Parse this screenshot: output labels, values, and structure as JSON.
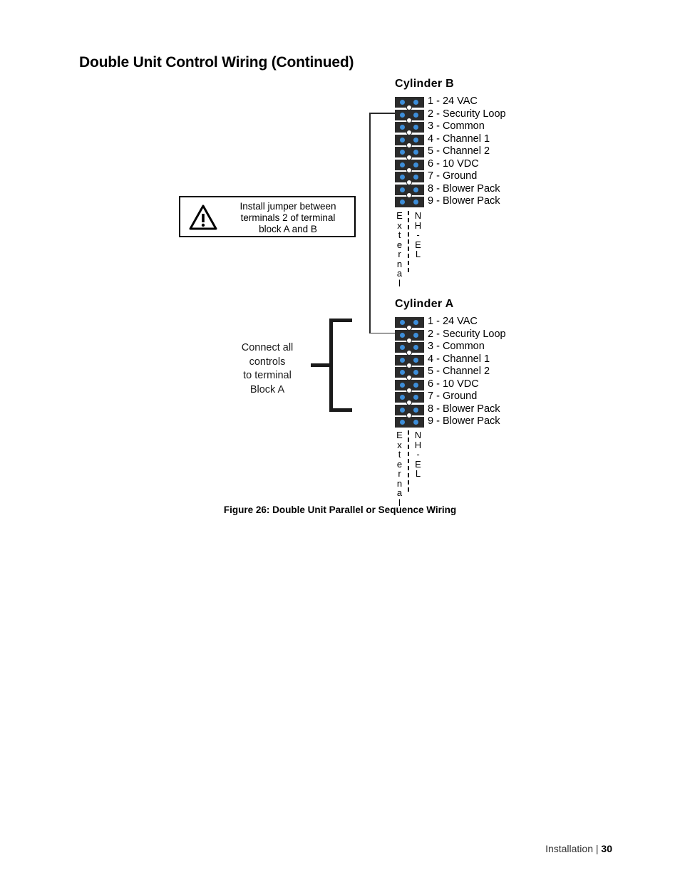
{
  "page": {
    "title": "Double Unit Control Wiring (Continued)",
    "figure_caption": "Figure 26: Double Unit Parallel or Sequence Wiring",
    "footer": {
      "section": "Installation",
      "separator": "|",
      "page_number": "30"
    }
  },
  "colors": {
    "terminal_block": "#2b2b2b",
    "terminal_dot": "#3d8ed9",
    "screw": "#ffffff",
    "wire": "#1a1a1a",
    "text": "#000000"
  },
  "warning": {
    "icon": "warning-triangle-icon",
    "line1": "Install jumper between",
    "line2": "terminals 2 of terminal",
    "line3": "block A and B"
  },
  "connect_note": {
    "line1": "Connect all",
    "line2": "controls",
    "line3": "to terminal",
    "line4": "Block A"
  },
  "terminal_labels": {
    "left_header": "External",
    "right_header": "NH-EL",
    "left_chars": [
      "E",
      "x",
      "t",
      "e",
      "r",
      "n",
      "a",
      "l"
    ],
    "right_chars": [
      "N",
      "H",
      "-",
      "E",
      "L"
    ]
  },
  "cylinders": [
    {
      "id": "cylinder-b",
      "heading": "Cylinder B",
      "terminals": [
        {
          "number": "1",
          "label": "1 - 24 VAC"
        },
        {
          "number": "2",
          "label": "2 - Security Loop"
        },
        {
          "number": "3",
          "label": "3 - Common"
        },
        {
          "number": "4",
          "label": "4 - Channel 1"
        },
        {
          "number": "5",
          "label": "5 - Channel 2"
        },
        {
          "number": "6",
          "label": "6 - 10 VDC"
        },
        {
          "number": "7",
          "label": "7 - Ground"
        },
        {
          "number": "8",
          "label": "8 - Blower Pack"
        },
        {
          "number": "9",
          "label": "9 - Blower Pack"
        }
      ]
    },
    {
      "id": "cylinder-a",
      "heading": "Cylinder A",
      "terminals": [
        {
          "number": "1",
          "label": "1 - 24 VAC"
        },
        {
          "number": "2",
          "label": "2 - Security Loop"
        },
        {
          "number": "3",
          "label": "3 - Common"
        },
        {
          "number": "4",
          "label": "4 - Channel 1"
        },
        {
          "number": "5",
          "label": "5 - Channel 2"
        },
        {
          "number": "6",
          "label": "6 - 10 VDC"
        },
        {
          "number": "7",
          "label": "7 - Ground"
        },
        {
          "number": "8",
          "label": "8 - Blower Pack"
        },
        {
          "number": "9",
          "label": "9 - Blower Pack"
        }
      ]
    }
  ]
}
